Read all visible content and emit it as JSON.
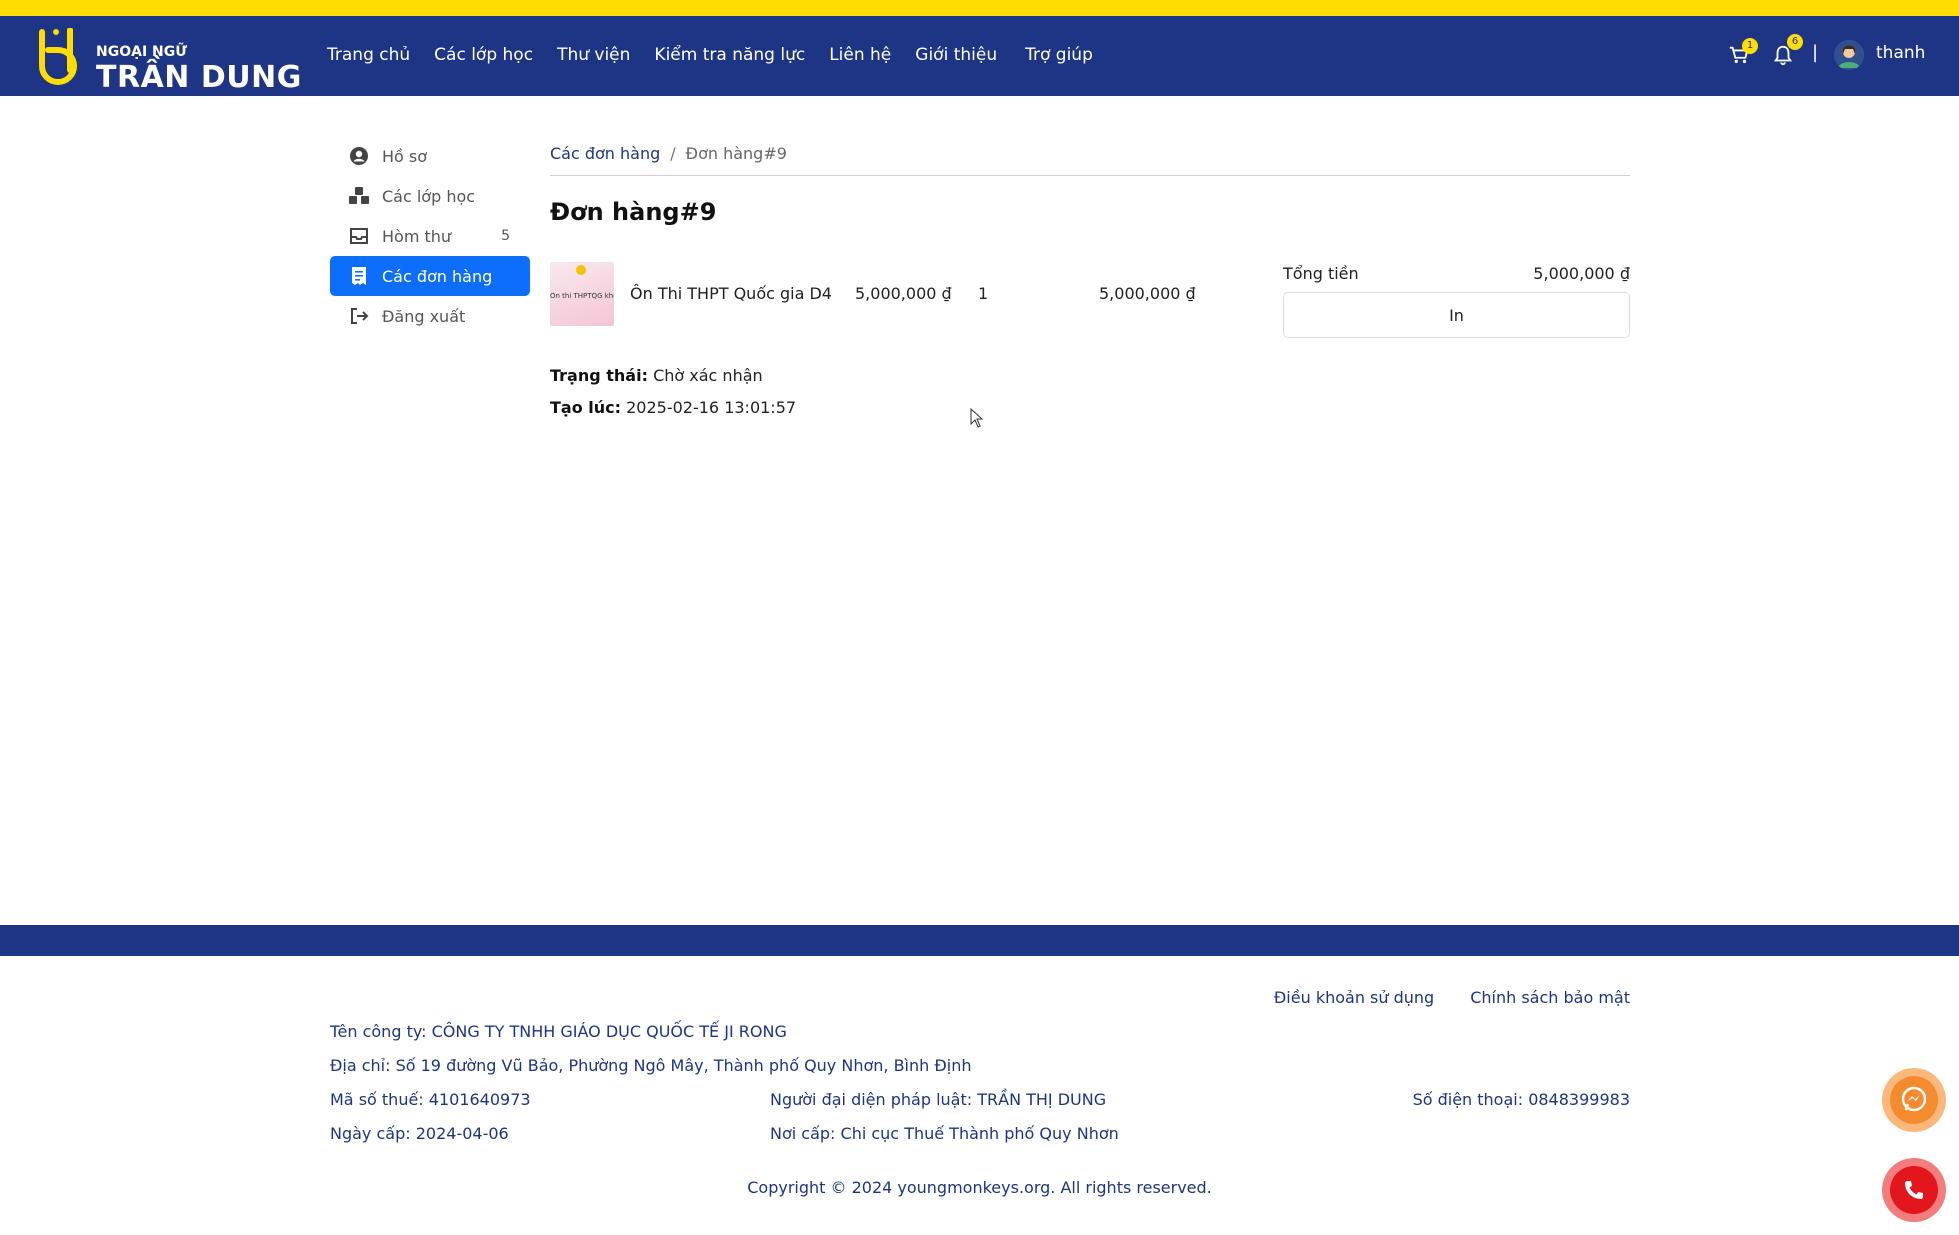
{
  "brand": {
    "line1": "NGOẠI NGỮ",
    "line2": "TRẦN DUNG",
    "accent": "#ffdd00",
    "header_bg": "#1d3584"
  },
  "nav": [
    {
      "label": "Trang chủ"
    },
    {
      "label": "Các lớp học"
    },
    {
      "label": "Thư viện"
    },
    {
      "label": "Kiểm tra năng lực"
    },
    {
      "label": "Liên hệ"
    },
    {
      "label": "Giới thiệu"
    },
    {
      "label": "Trợ giúp"
    }
  ],
  "header_right": {
    "cart_icon": "cart-icon",
    "cart_count": "1",
    "bell_icon": "bell-icon",
    "notification_count": "6",
    "separator": "|",
    "username": "thanh"
  },
  "sidebar": {
    "items": [
      {
        "label": "Hồ sơ",
        "icon": "user-circle-icon"
      },
      {
        "label": "Các lớp học",
        "icon": "cubes-icon"
      },
      {
        "label": "Hòm thư",
        "icon": "inbox-icon",
        "count": "5"
      },
      {
        "label": "Các đơn hàng",
        "icon": "receipt-icon",
        "active": true
      },
      {
        "label": "Đăng xuất",
        "icon": "sign-out-icon"
      }
    ],
    "active_color": "#0d6efd"
  },
  "breadcrumb": {
    "parent": "Các đơn hàng",
    "separator": "/",
    "current": "Đơn hàng#9"
  },
  "order": {
    "title": "Đơn hàng#9",
    "item": {
      "thumbnail_text": "Ôn thi THPTQG khối D",
      "name": "Ôn Thi THPT Quốc gia D4",
      "price": "5,000,000 ₫",
      "quantity": "1",
      "subtotal": "5,000,000 ₫"
    },
    "total_label": "Tổng tiền",
    "total_value": "5,000,000 ₫",
    "print_label": "In",
    "status_label": "Trạng thái:",
    "status_value": "Chờ xác nhận",
    "created_label": "Tạo lúc:",
    "created_value": "2025-02-16 13:01:57"
  },
  "footer": {
    "terms": "Điều khoản sử dụng",
    "privacy": "Chính sách bảo mật",
    "company": "Tên công ty: CÔNG TY TNHH GIÁO DỤC QUỐC TẾ JI RONG",
    "address": "Địa chỉ: Số 19 đường Vũ Bảo, Phường Ngô Mây, Thành phố Quy Nhơn, Bình Định",
    "tax_code": "Mã số thuế: 4101640973",
    "legal_rep": "Người đại diện pháp luật: TRẦN THỊ DUNG",
    "phone": "Số điện thoại: 0848399983",
    "issue_date": "Ngày cấp: 2024-04-06",
    "issue_place": "Nơi cấp: Chi cục Thuế Thành phố Quy Nhơn",
    "copyright": "Copyright © 2024 youngmonkeys.org. All rights reserved."
  },
  "floating": {
    "messenger_icon": "messenger-icon",
    "phone_icon": "phone-icon"
  }
}
